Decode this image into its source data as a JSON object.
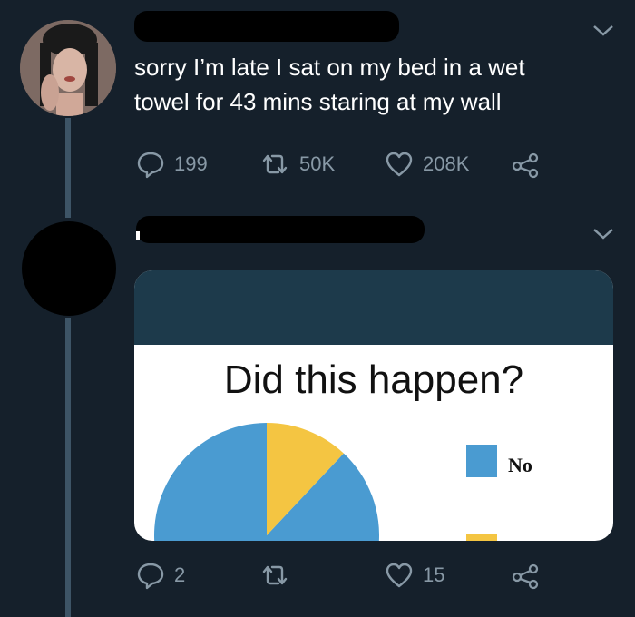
{
  "tweet1": {
    "text_line1": "sorry I’m late I sat on my bed in a wet",
    "text_line2": "towel for 43 mins staring at my wall",
    "actions": {
      "replies": "199",
      "retweets": "50K",
      "likes": "208K"
    }
  },
  "tweet2": {
    "card": {
      "title": "Did this happen?",
      "legend": [
        {
          "label": "No",
          "color": "#4a9bd1"
        },
        {
          "label": "",
          "color": "#f4c542"
        }
      ]
    },
    "actions": {
      "replies": "2",
      "retweets": "",
      "likes": "15"
    }
  },
  "colors": {
    "background": "#15202b",
    "secondary_text": "#8899a6",
    "pie_blue": "#4a9bd1",
    "pie_yellow": "#f4c542"
  },
  "chart_data": {
    "type": "pie",
    "title": "Did this happen?",
    "categories": [
      "No",
      ""
    ],
    "values": [
      88,
      12
    ]
  }
}
